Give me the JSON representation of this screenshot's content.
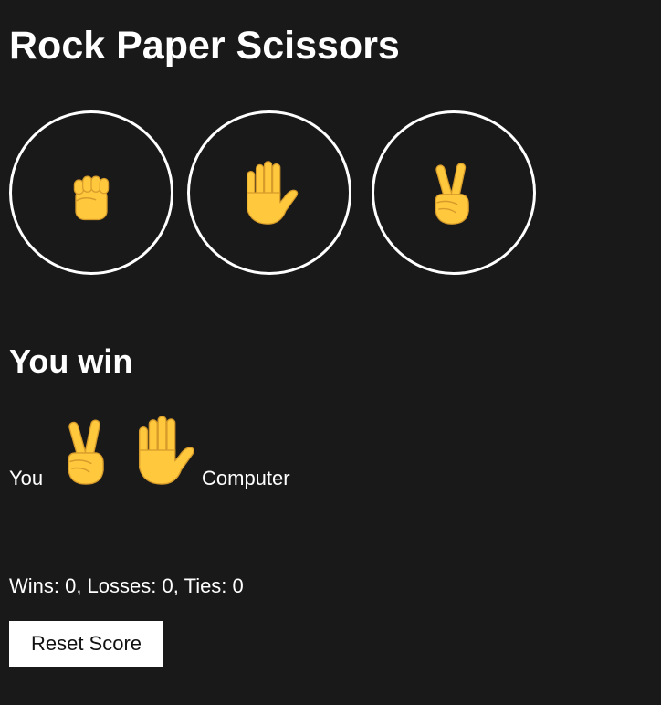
{
  "header": {
    "title": "Rock Paper Scissors"
  },
  "choices": [
    {
      "name": "rock",
      "icon": "raised-fist-icon"
    },
    {
      "name": "paper",
      "icon": "raised-hand-icon"
    },
    {
      "name": "scissors",
      "icon": "victory-hand-icon"
    }
  ],
  "result": {
    "message": "You win",
    "you_label": "You",
    "computer_label": "Computer",
    "you_move_icon": "victory-hand-icon",
    "computer_move_icon": "raised-hand-icon"
  },
  "score": {
    "text": "Wins: 0, Losses: 0, Ties: 0"
  },
  "controls": {
    "reset_label": "Reset Score"
  },
  "colors": {
    "background": "#191919",
    "text": "#ffffff",
    "hand_fill": "#FFC83D",
    "hand_outline": "#D69B2B",
    "button_bg": "#ffffff"
  }
}
